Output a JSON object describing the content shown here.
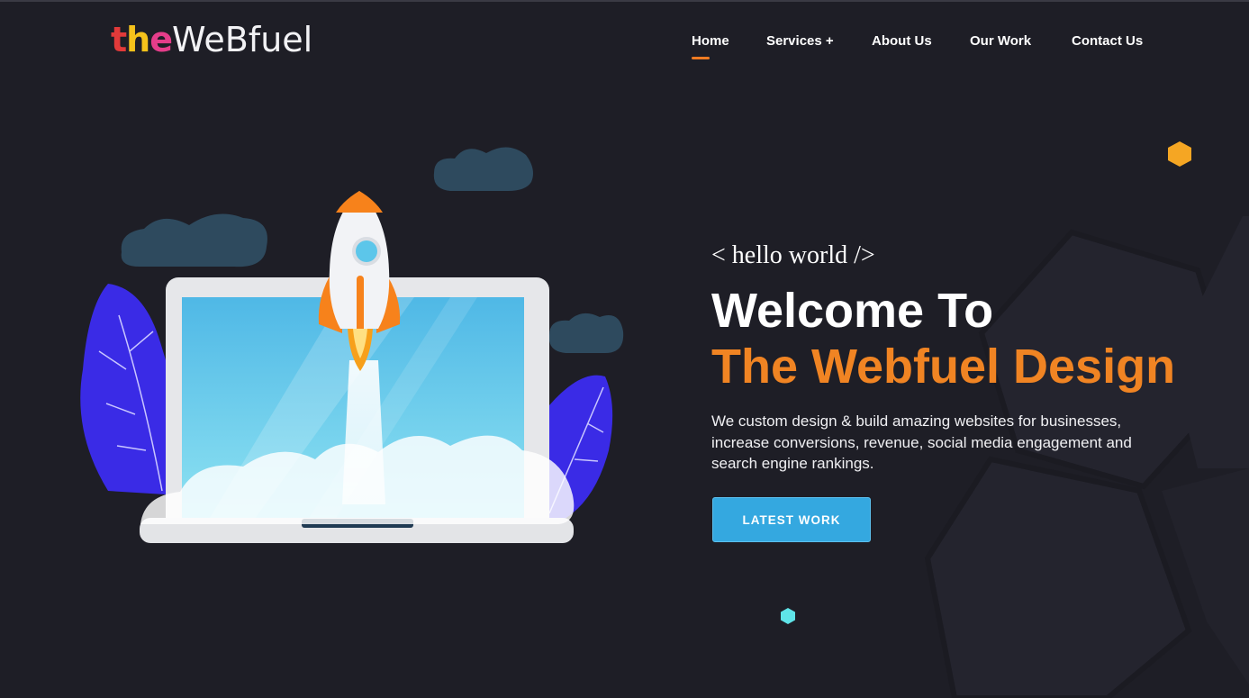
{
  "logo": {
    "parts": [
      "t",
      "h",
      "e",
      "WeBfuel"
    ]
  },
  "nav": {
    "items": [
      {
        "label": "Home",
        "active": true
      },
      {
        "label": "Services +",
        "active": false
      },
      {
        "label": "About Us",
        "active": false
      },
      {
        "label": "Our Work",
        "active": false
      },
      {
        "label": "Contact Us",
        "active": false
      }
    ]
  },
  "hero": {
    "tagline": "< hello world />",
    "title_line1": "Welcome To",
    "title_line2": "The Webfuel Design",
    "description": "We custom design & build amazing websites for businesses, increase conversions, revenue, social media engagement and search engine rankings.",
    "cta_label": "LATEST WORK"
  },
  "colors": {
    "background": "#1e1e26",
    "accent_orange": "#f08423",
    "button_blue": "#34a8e0",
    "nav_underline": "#ef7b22"
  },
  "icons": [
    "rocket-illustration",
    "laptop-illustration",
    "cloud-shape",
    "leaf-shape",
    "hexagon-decoration"
  ]
}
